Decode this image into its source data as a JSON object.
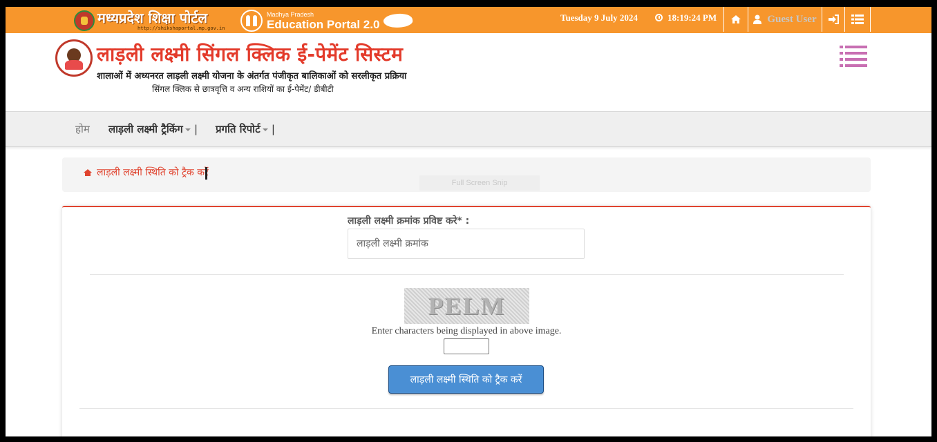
{
  "topbar": {
    "portal_title": "मध्यप्रदेश शिक्षा पोर्टल",
    "portal_url": "http://shikshaportal.mp.gov.in",
    "edu_small": "Madhya Pradesh",
    "edu_big": "Education Portal 2.0",
    "date": "Tuesday 9 July 2024",
    "time": "18:19:24 PM",
    "user_label": "Guest User",
    "bg_color": "#f7962c"
  },
  "header": {
    "title": "लाड़ली लक्ष्मी सिंगल क्लिक ई-पेमेंट सिस्टम",
    "subtitle1": "शालाओं में अध्यनरत लाड़ली लक्ष्मी योजना के अंतर्गत पंजीकृत बालिकाओं को सरलीकृत प्रक्रिया",
    "subtitle2": "सिंगल क्लिक से छात्रवृत्ति व अन्य राशियों का ई-पेमेंट/ डीबीटी",
    "title_color": "#e33a2a"
  },
  "nav": {
    "home": "होम",
    "tracking": "लाड़ली लक्ष्मी ट्रैकिंग",
    "report": "प्रगति रिपोर्ट",
    "sep": "|"
  },
  "breadcrumb": {
    "text": "लाड़ली लक्ष्मी स्थिति को ट्रैक करें",
    "ghost": "Full Screen Snip"
  },
  "form": {
    "field_label": "लाड़ली लक्ष्मी क्रमांक प्रविष्ट करे* :",
    "field_placeholder": "लाड़ली लक्ष्मी क्रमांक",
    "captcha_text": "PELM",
    "captcha_hint": "Enter characters being displayed in above image.",
    "captcha_value": "",
    "submit_label": "लाड़ली लक्ष्मी स्थिति को ट्रैक करें",
    "accent_color": "#4a8fd4"
  }
}
